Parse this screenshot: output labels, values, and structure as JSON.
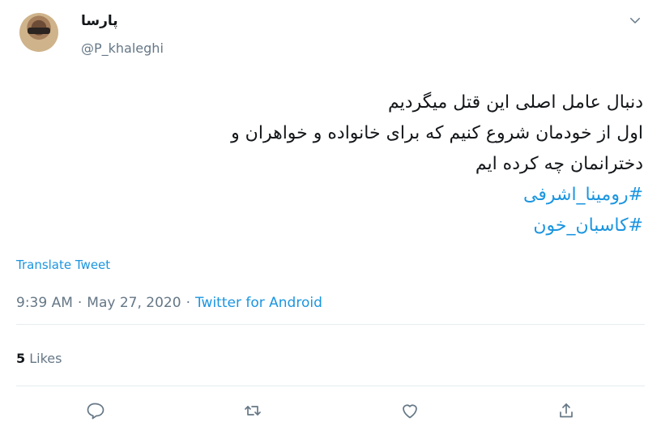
{
  "user": {
    "display_name": "پارسا",
    "handle": "@P_khaleghi"
  },
  "tweet": {
    "lines": [
      "دنبال عامل اصلی این قتل میگردیم",
      "اول از خودمان شروع کنیم که برای خانواده و خواهران و",
      "دخترانمان چه کرده ایم"
    ],
    "hashtags": [
      "#رومینا_اشرفی",
      "#کاسبان_خون"
    ]
  },
  "translate_label": "Translate Tweet",
  "meta": {
    "time": "9:39 AM",
    "separator": "·",
    "date": "May 27, 2020",
    "source": "Twitter for Android"
  },
  "stats": {
    "likes_count": "5",
    "likes_label": "Likes"
  },
  "actions": {
    "reply_icon": "reply-icon",
    "retweet_icon": "retweet-icon",
    "like_icon": "heart-icon",
    "share_icon": "share-icon"
  },
  "colors": {
    "accent": "#1b95e0",
    "secondary_text": "#657786",
    "divider": "#e6ecf0"
  }
}
